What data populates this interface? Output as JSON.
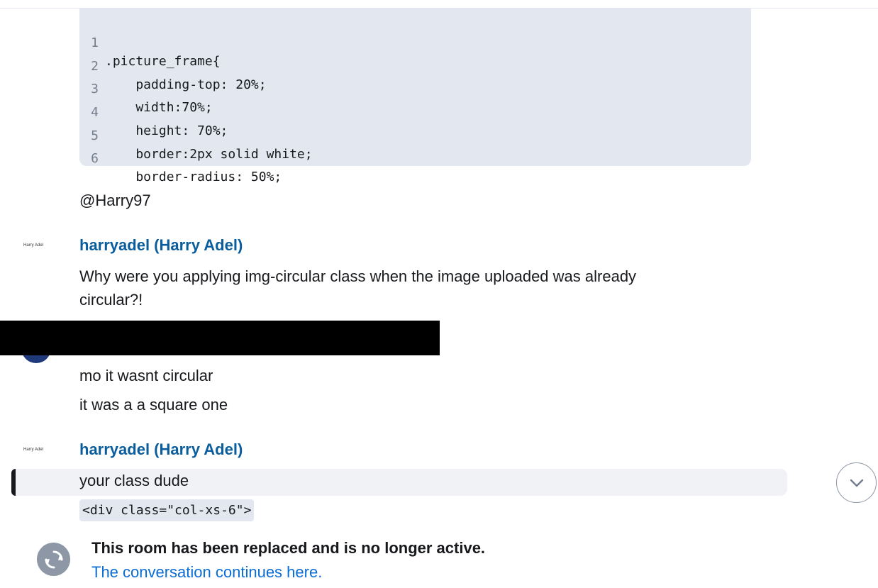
{
  "code_block": {
    "lines": [
      {
        "num": "1",
        "text": ".picture_frame{"
      },
      {
        "num": "2",
        "text": "    padding-top: 20%;"
      },
      {
        "num": "3",
        "text": "    width:70%;"
      },
      {
        "num": "4",
        "text": "    height: 70%;"
      },
      {
        "num": "5",
        "text": "    border:2px solid white;"
      },
      {
        "num": "6",
        "text": "    border-radius: 50%;"
      }
    ]
  },
  "messages": {
    "mention": "@Harry97",
    "msg1": {
      "sender": "harryadel (Harry Adel)",
      "avatar_text": "Harry Adel",
      "body": "Why were you applying img-circular class when the image uploaded was already circular?!"
    },
    "msg2": {
      "line1": "mo it wasnt circular",
      "line2": "it was a a square one"
    },
    "msg3": {
      "sender": "harryadel (Harry Adel)",
      "avatar_text": "Harry Adel",
      "body": "your class dude",
      "code": "<div class=\"col-xs-6\">"
    }
  },
  "tombstone": {
    "title": "This room has been replaced and is no longer active.",
    "link": "The conversation continues here."
  },
  "icons": {
    "scroll_down": "chevron-down-icon",
    "room_upgrade": "room-replaced-icon"
  }
}
